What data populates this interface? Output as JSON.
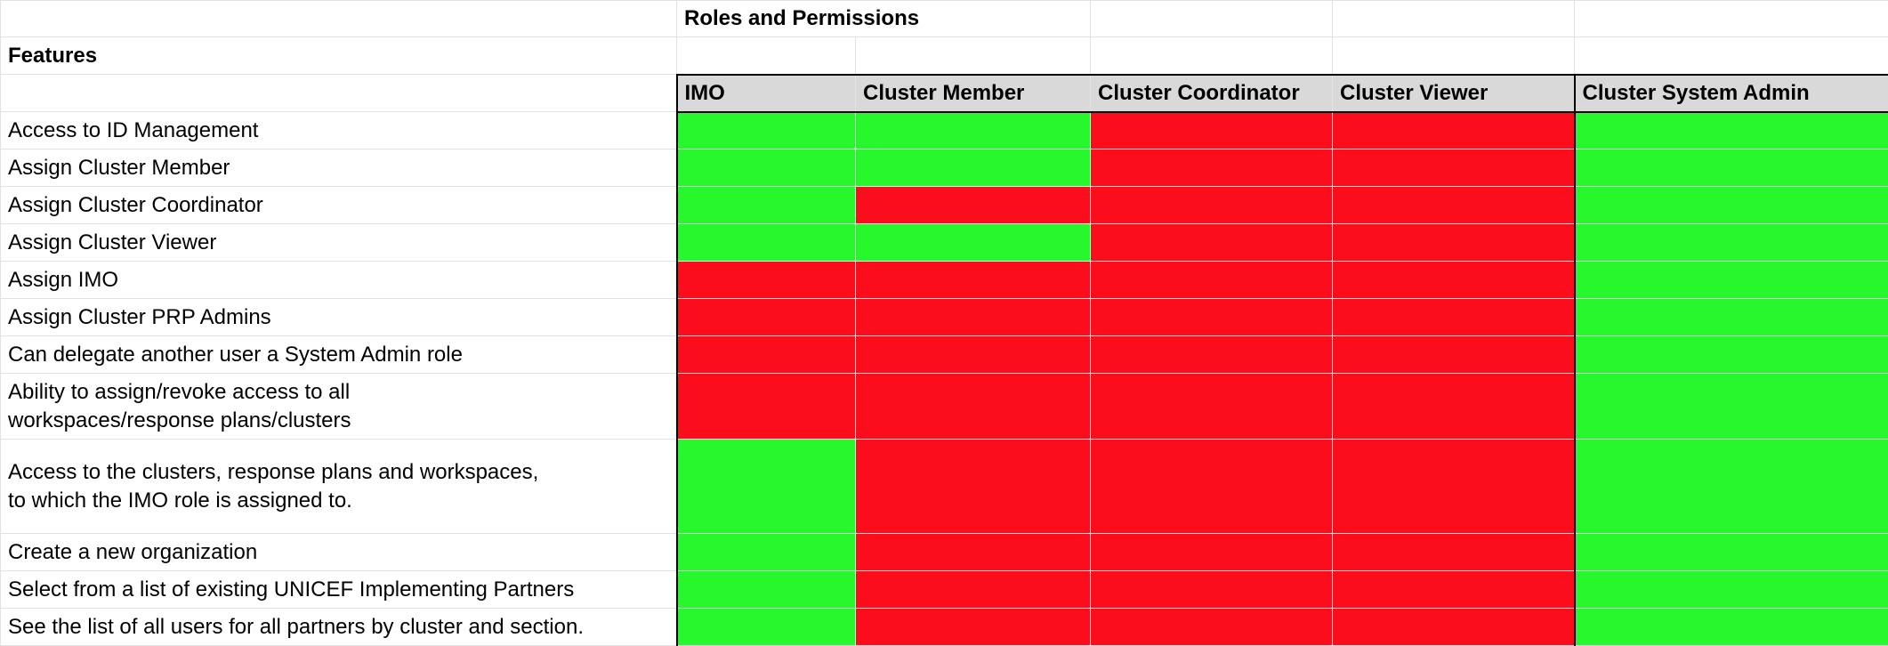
{
  "title": "Roles and Permissions",
  "features_label": "Features",
  "colors": {
    "allowed": "#27f82e",
    "denied": "#fc0d1b",
    "header_bg": "#d9d9d9"
  },
  "roles": [
    "IMO",
    "Cluster Member",
    "Cluster Coordinator",
    "Cluster Viewer",
    "Cluster System Admin"
  ],
  "rows": [
    {
      "feature": "Access to ID Management",
      "permissions": [
        true,
        true,
        false,
        false,
        true
      ]
    },
    {
      "feature": "Assign Cluster Member",
      "permissions": [
        true,
        true,
        false,
        false,
        true
      ]
    },
    {
      "feature": "Assign Cluster Coordinator",
      "permissions": [
        true,
        false,
        false,
        false,
        true
      ]
    },
    {
      "feature": "Assign Cluster Viewer",
      "permissions": [
        true,
        true,
        false,
        false,
        true
      ]
    },
    {
      "feature": "Assign IMO",
      "permissions": [
        false,
        false,
        false,
        false,
        true
      ]
    },
    {
      "feature": "Assign Cluster PRP Admins",
      "permissions": [
        false,
        false,
        false,
        false,
        true
      ]
    },
    {
      "feature": "Can delegate another user a System Admin role",
      "permissions": [
        false,
        false,
        false,
        false,
        true
      ]
    },
    {
      "feature": "Ability to assign/revoke access to all\nworkspaces/response plans/clusters",
      "permissions": [
        false,
        false,
        false,
        false,
        true
      ]
    },
    {
      "feature": "Access to the clusters, response plans and workspaces,\nto which the IMO role is assigned to.",
      "permissions": [
        true,
        false,
        false,
        false,
        true
      ]
    },
    {
      "feature": "Create a new organization",
      "permissions": [
        true,
        false,
        false,
        false,
        true
      ]
    },
    {
      "feature": "Select from a list of existing UNICEF Implementing Partners",
      "permissions": [
        true,
        false,
        false,
        false,
        true
      ]
    },
    {
      "feature": "See the list of all users for all partners by cluster and section.",
      "permissions": [
        true,
        false,
        false,
        false,
        true
      ]
    }
  ]
}
